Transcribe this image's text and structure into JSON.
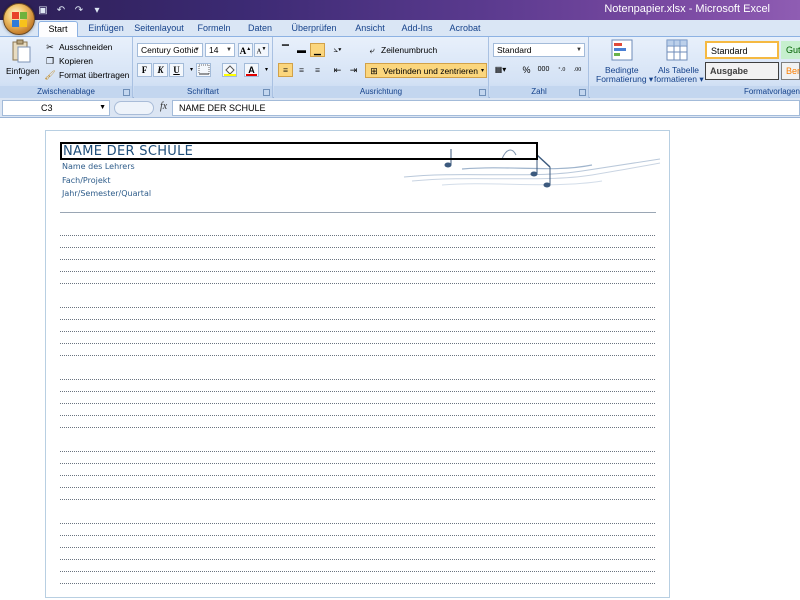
{
  "window": {
    "title": "Notenpapier.xlsx - Microsoft Excel"
  },
  "tabs": [
    {
      "label": "Start"
    },
    {
      "label": "Einfügen"
    },
    {
      "label": "Seitenlayout"
    },
    {
      "label": "Formeln"
    },
    {
      "label": "Daten"
    },
    {
      "label": "Überprüfen"
    },
    {
      "label": "Ansicht"
    },
    {
      "label": "Add-Ins"
    },
    {
      "label": "Acrobat"
    }
  ],
  "ribbon": {
    "clipboard": {
      "label": "Zwischenablage",
      "paste": "Einfügen",
      "cut": "Ausschneiden",
      "copy": "Kopieren",
      "format_painter": "Format übertragen"
    },
    "font": {
      "label": "Schriftart",
      "font_name": "Century Gothic",
      "font_size": "14",
      "bold": "F",
      "italic": "K",
      "underline": "U"
    },
    "alignment": {
      "label": "Ausrichtung",
      "wrap": "Zeilenumbruch",
      "merge": "Verbinden und zentrieren"
    },
    "number": {
      "label": "Zahl",
      "format": "Standard",
      "percent": "%",
      "thousands": "000"
    },
    "styles": {
      "label": "Formatvorlagen",
      "cond_format": "Bedingte Formatierung",
      "as_table": "Als Tabelle formatieren",
      "standard": "Standard",
      "output": "Ausgabe",
      "good": "Gut",
      "calc": "Ber"
    }
  },
  "formula_bar": {
    "cell_ref": "C3",
    "fx": "fx",
    "content": "NAME DER SCHULE"
  },
  "sheet": {
    "school": "NAME DER SCHULE",
    "teacher": "Name des Lehrers",
    "subject": "Fach/Projekt",
    "term": "Jahr/Semester/Quartal"
  },
  "colors": {
    "ribbon_text": "#15428b",
    "title_blue": "#1f4e79",
    "highlight": "#fbd67d"
  }
}
